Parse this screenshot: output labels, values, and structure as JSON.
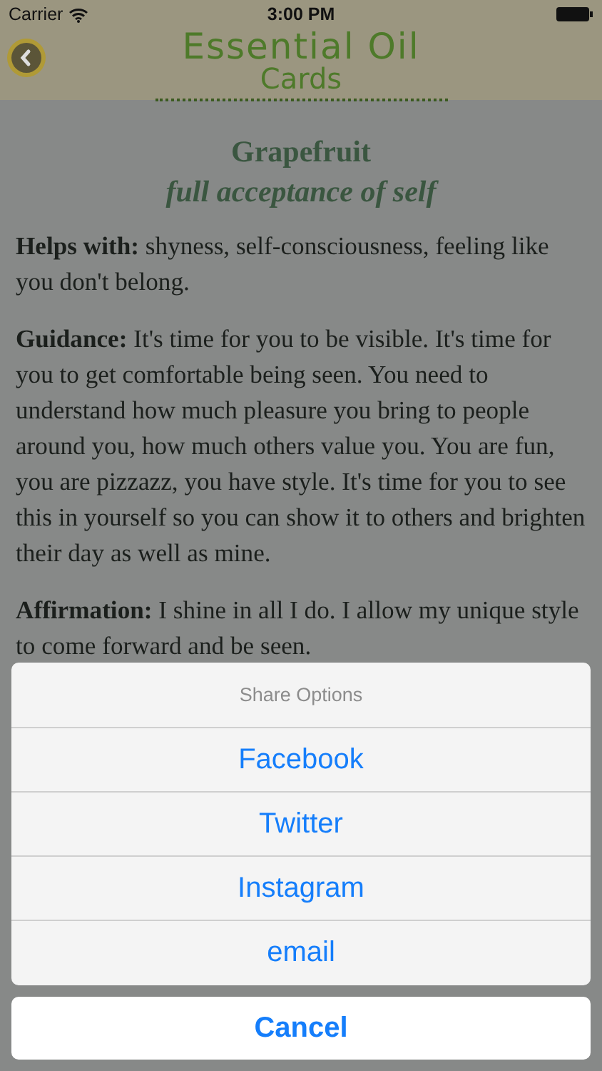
{
  "status_bar": {
    "carrier": "Carrier",
    "time": "3:00 PM"
  },
  "nav_bar": {
    "title_line_1": "Essential Oil",
    "title_line_2": "Cards"
  },
  "card": {
    "title": "Grapefruit",
    "subtitle": "full acceptance of self",
    "sections": [
      {
        "label": "Helps with:",
        "text": "shyness, self-consciousness, feeling like you don't belong."
      },
      {
        "label": "Guidance:",
        "text": "It's time for you to be visible. It's time for you to get comfortable being seen. You need to understand how much pleasure you bring to people around you, how much others value you. You are fun, you are pizzazz, you have style. It's time for you to see this in yourself so you can show it to others and brighten their day as well as mine."
      },
      {
        "label": "Affirmation:",
        "text": "I shine in all I do. I allow my unique style to come forward and be seen."
      }
    ]
  },
  "action_sheet": {
    "title": "Share Options",
    "options": [
      {
        "label": "Facebook",
        "kind": "action"
      },
      {
        "label": "Twitter",
        "kind": "action"
      },
      {
        "label": "Instagram",
        "kind": "action"
      },
      {
        "label": "email",
        "kind": "action"
      },
      {
        "label": "Cancel",
        "kind": "cancel"
      }
    ]
  }
}
